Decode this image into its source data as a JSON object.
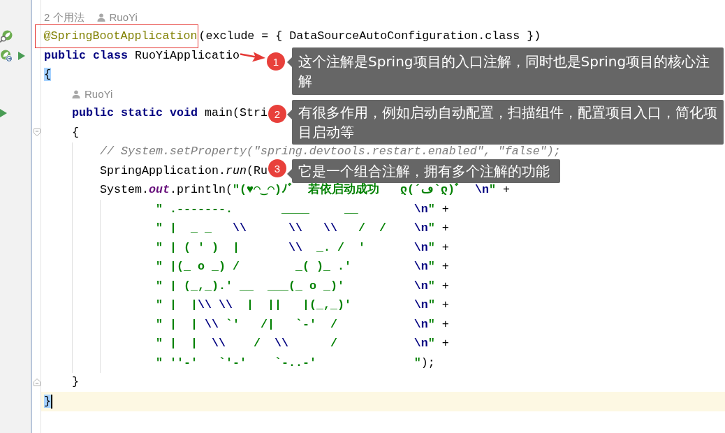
{
  "editor": {
    "lines": [
      {
        "kind": "hint",
        "current": false,
        "usages": "2 个用法",
        "author": "RuoYi"
      },
      {
        "kind": "code",
        "current": false,
        "gutter_icons": [
          {
            "kind": "bean"
          }
        ],
        "tokens": [
          {
            "kind": "annotation",
            "text": "@SpringBootApplication"
          },
          {
            "kind": "plain",
            "text": "(exclude = { DataSourceAutoConfiguration.class })"
          }
        ]
      },
      {
        "kind": "code",
        "current": false,
        "gutter_icons": [
          {
            "kind": "bean-class"
          },
          {
            "kind": "run"
          }
        ],
        "tokens": [
          {
            "kind": "keyword",
            "text": "public class"
          },
          {
            "kind": "plain",
            "text": " RuoYiApplicatio"
          }
        ]
      },
      {
        "kind": "brace",
        "current": false,
        "tokens": [
          {
            "kind": "matched-brace",
            "text": "{"
          }
        ],
        "children": [
          {
            "kind": "hint",
            "current": false,
            "author": "RuoYi"
          },
          {
            "kind": "code",
            "current": false,
            "gutter_icons": [
              {
                "kind": "run"
              }
            ],
            "tokens": [
              {
                "kind": "keyword",
                "text": "public static void"
              },
              {
                "kind": "plain",
                "text": " main(Stri"
              }
            ]
          },
          {
            "kind": "brace",
            "current": false,
            "fold_marker": {
              "kind": "start"
            },
            "tokens": [
              {
                "kind": "plain",
                "text": "{"
              }
            ],
            "children": [
              {
                "kind": "code",
                "current": false,
                "tokens": [
                  {
                    "kind": "comment",
                    "text": "// System.setProperty(\"spring.devtools.restart.enabled\", \"false\");"
                  }
                ]
              },
              {
                "kind": "code",
                "current": false,
                "tokens": [
                  {
                    "kind": "plain",
                    "text": "SpringApplication."
                  },
                  {
                    "kind": "static-method",
                    "text": "run"
                  },
                  {
                    "kind": "plain",
                    "text": "(Ru"
                  }
                ]
              },
              {
                "kind": "code",
                "current": false,
                "tokens": [
                  {
                    "kind": "plain",
                    "text": "System."
                  },
                  {
                    "kind": "static-field",
                    "text": "out"
                  },
                  {
                    "kind": "plain",
                    "text": ".println("
                  },
                  {
                    "kind": "string",
                    "text": "\"(♥◠‿◠)ﾉﾞ  若依启动成功   ლ(´ڡ`ლ)ﾞ  "
                  },
                  {
                    "kind": "escape",
                    "text": "\\n"
                  },
                  {
                    "kind": "string",
                    "text": "\""
                  },
                  {
                    "kind": "plain",
                    "text": " +"
                  }
                ],
                "children": [
                  {
                    "kind": "code",
                    "current": false,
                    "tokens": [
                      {
                        "kind": "string",
                        "text": "\" .-------.       ____     __        "
                      },
                      {
                        "kind": "escape",
                        "text": "\\n"
                      },
                      {
                        "kind": "string",
                        "text": "\""
                      },
                      {
                        "kind": "plain",
                        "text": " +"
                      }
                    ]
                  },
                  {
                    "kind": "code",
                    "current": false,
                    "tokens": [
                      {
                        "kind": "string",
                        "text": "\" |  _ _   "
                      },
                      {
                        "kind": "escape",
                        "text": "\\\\      "
                      },
                      {
                        "kind": "escape",
                        "text": "\\\\   "
                      },
                      {
                        "kind": "escape",
                        "text": "\\\\"
                      },
                      {
                        "kind": "string",
                        "text": "   /  /    "
                      },
                      {
                        "kind": "escape",
                        "text": "\\n"
                      },
                      {
                        "kind": "string",
                        "text": "\""
                      },
                      {
                        "kind": "plain",
                        "text": " +"
                      }
                    ]
                  },
                  {
                    "kind": "code",
                    "current": false,
                    "tokens": [
                      {
                        "kind": "string",
                        "text": "\" | ( ' )  |       "
                      },
                      {
                        "kind": "escape",
                        "text": "\\\\"
                      },
                      {
                        "kind": "string",
                        "text": "  _. /  '       "
                      },
                      {
                        "kind": "escape",
                        "text": "\\n"
                      },
                      {
                        "kind": "string",
                        "text": "\""
                      },
                      {
                        "kind": "plain",
                        "text": " +"
                      }
                    ]
                  },
                  {
                    "kind": "code",
                    "current": false,
                    "tokens": [
                      {
                        "kind": "string",
                        "text": "\" |(_ o _) /        _( )_ .'         "
                      },
                      {
                        "kind": "escape",
                        "text": "\\n"
                      },
                      {
                        "kind": "string",
                        "text": "\""
                      },
                      {
                        "kind": "plain",
                        "text": " +"
                      }
                    ]
                  },
                  {
                    "kind": "code",
                    "current": false,
                    "tokens": [
                      {
                        "kind": "string",
                        "text": "\" | (_,_).' __  ___(_ o _)'          "
                      },
                      {
                        "kind": "escape",
                        "text": "\\n"
                      },
                      {
                        "kind": "string",
                        "text": "\""
                      },
                      {
                        "kind": "plain",
                        "text": " +"
                      }
                    ]
                  },
                  {
                    "kind": "code",
                    "current": false,
                    "tokens": [
                      {
                        "kind": "string",
                        "text": "\" |  |"
                      },
                      {
                        "kind": "escape",
                        "text": "\\\\ "
                      },
                      {
                        "kind": "escape",
                        "text": "\\\\"
                      },
                      {
                        "kind": "string",
                        "text": "  |  ||   |(_,_)'         "
                      },
                      {
                        "kind": "escape",
                        "text": "\\n"
                      },
                      {
                        "kind": "string",
                        "text": "\""
                      },
                      {
                        "kind": "plain",
                        "text": " +"
                      }
                    ]
                  },
                  {
                    "kind": "code",
                    "current": false,
                    "tokens": [
                      {
                        "kind": "string",
                        "text": "\" |  | "
                      },
                      {
                        "kind": "escape",
                        "text": "\\\\"
                      },
                      {
                        "kind": "string",
                        "text": " `'   /|   `-'  /           "
                      },
                      {
                        "kind": "escape",
                        "text": "\\n"
                      },
                      {
                        "kind": "string",
                        "text": "\""
                      },
                      {
                        "kind": "plain",
                        "text": " +"
                      }
                    ]
                  },
                  {
                    "kind": "code",
                    "current": false,
                    "tokens": [
                      {
                        "kind": "string",
                        "text": "\" |  |  "
                      },
                      {
                        "kind": "escape",
                        "text": "\\\\"
                      },
                      {
                        "kind": "string",
                        "text": "    /  "
                      },
                      {
                        "kind": "escape",
                        "text": "\\\\"
                      },
                      {
                        "kind": "string",
                        "text": "      /           "
                      },
                      {
                        "kind": "escape",
                        "text": "\\n"
                      },
                      {
                        "kind": "string",
                        "text": "\""
                      },
                      {
                        "kind": "plain",
                        "text": " +"
                      }
                    ]
                  },
                  {
                    "kind": "code",
                    "current": false,
                    "tokens": [
                      {
                        "kind": "string",
                        "text": "\" ''-'   `'-'    `-..-'              \""
                      },
                      {
                        "kind": "plain",
                        "text": ");"
                      }
                    ]
                  }
                ]
              }
            ]
          },
          {
            "kind": "code",
            "current": false,
            "fold_marker": {
              "kind": "end"
            },
            "tokens": [
              {
                "kind": "plain",
                "text": "}"
              }
            ]
          }
        ]
      },
      {
        "kind": "code",
        "current": true,
        "tokens": [
          {
            "kind": "matched-brace",
            "text": "}"
          }
        ]
      }
    ]
  },
  "callouts": [
    {
      "number": "1",
      "text": "这个注解是Spring项目的入口注解，同时也是Spring项目的核心注解"
    },
    {
      "number": "2",
      "text": "有很多作用，例如启动自动配置，扫描组件，配置项目入口，简化项目启动等"
    },
    {
      "number": "3",
      "text": "它是一个组合注解，拥有多个注解的功能"
    }
  ]
}
